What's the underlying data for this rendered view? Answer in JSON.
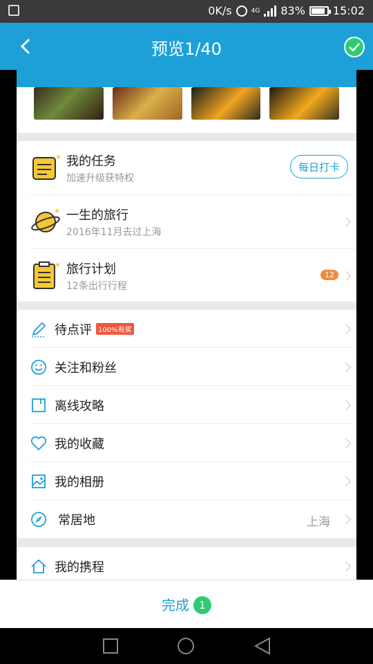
{
  "status_bar": {
    "speed": "0K/s",
    "network": "4G",
    "battery": "83%",
    "time": "15:02"
  },
  "header": {
    "title": "预览1/40"
  },
  "tasks": {
    "title": "我的任务",
    "subtitle": "加速升级获特权",
    "checkin_label": "每日打卡"
  },
  "travel": {
    "title": "一生的旅行",
    "subtitle": "2016年11月去过上海"
  },
  "plan": {
    "title": "旅行计划",
    "subtitle": "12条出行行程",
    "badge": "12"
  },
  "menu": {
    "pending_review": "待点评",
    "pending_tag": "100%有奖",
    "follow": "关注和粉丝",
    "offline_guide": "离线攻略",
    "favorites": "我的收藏",
    "album": "我的相册",
    "residence": "常居地",
    "residence_value": "上海",
    "ctrip": "我的携程"
  },
  "footer": {
    "done_label": "完成",
    "done_count": "1"
  },
  "colors": {
    "brand": "#1da0d8",
    "confirm": "#2ecc71",
    "badge": "#f08a3c",
    "tag": "#f2553e"
  }
}
